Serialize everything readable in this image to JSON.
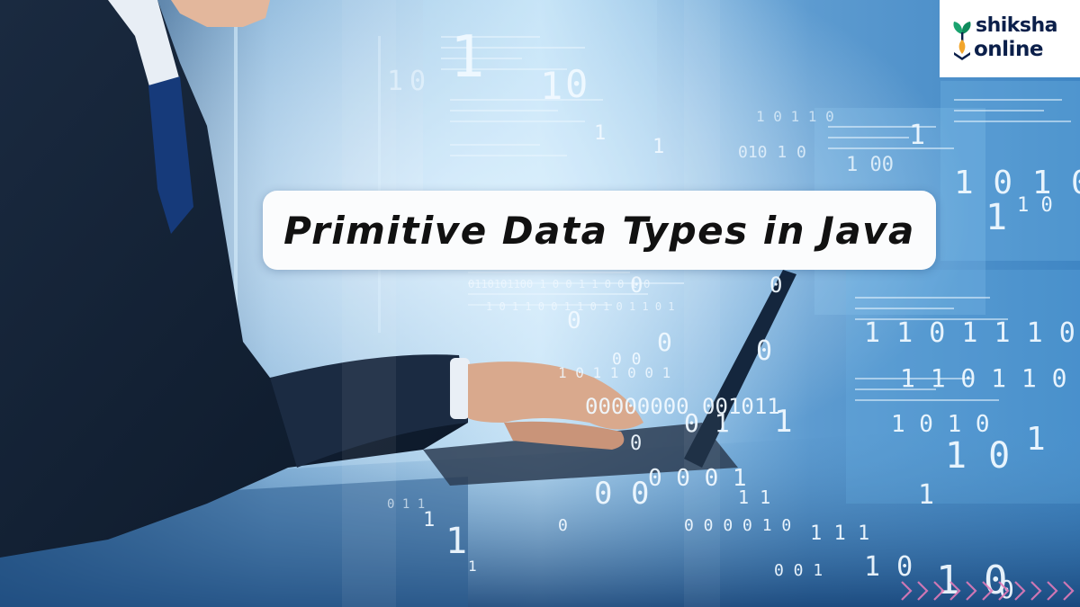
{
  "title": "Primitive Data Types in Java",
  "brand": {
    "line1": "shiksha",
    "line2": "online",
    "colors": {
      "text": "#0b1f4a",
      "leaf": "#1aa36f",
      "accent": "#f2a52b"
    }
  },
  "colors": {
    "background_dark": "#0b2c55",
    "background_light": "#a8d4f2",
    "title_card": "#fbfcfd",
    "chevrons": "#e07bb8"
  },
  "icons": [
    "shiksha-logo-icon",
    "chevron-arrows-icon"
  ]
}
